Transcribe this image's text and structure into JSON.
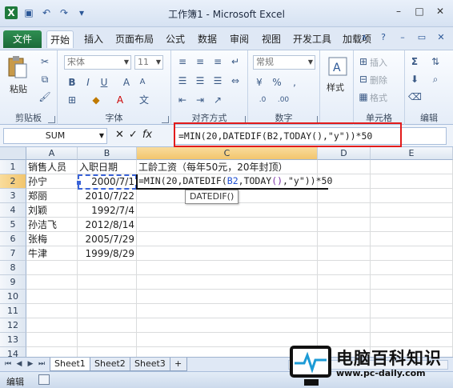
{
  "window": {
    "title": "工作簿1 - Microsoft Excel"
  },
  "tabs": [
    "文件",
    "开始",
    "插入",
    "页面布局",
    "公式",
    "数据",
    "审阅",
    "视图",
    "开发工具",
    "加载项"
  ],
  "ribbon": {
    "clipboard": {
      "label": "剪贴板",
      "paste": "粘贴"
    },
    "font": {
      "label": "字体",
      "name": "宋体",
      "size": "11"
    },
    "alignment": {
      "label": "对齐方式"
    },
    "number": {
      "label": "数字",
      "format": "常规"
    },
    "styles": {
      "label": "样式"
    },
    "cells": {
      "label": "单元格",
      "insert": "插入",
      "delete": "删除",
      "format": "格式"
    },
    "editing": {
      "label": "编辑"
    }
  },
  "formula_bar": {
    "name_box": "SUM",
    "cancel": "✕",
    "enter": "✓",
    "fx": "fx",
    "formula": "=MIN(20,DATEDIF(B2,TODAY(),\"y\"))*50"
  },
  "grid": {
    "columns": [
      "A",
      "B",
      "C",
      "D",
      "E"
    ],
    "rows": [
      "1",
      "2",
      "3",
      "4",
      "5",
      "6",
      "7",
      "8",
      "9",
      "10",
      "11",
      "12",
      "13",
      "14"
    ],
    "data": [
      [
        "销售人员",
        "入职日期",
        "工龄工资（每年50元，20年封顶）"
      ],
      [
        "孙宁",
        "2000/7/1",
        ""
      ],
      [
        "郑丽",
        "2010/7/22",
        ""
      ],
      [
        "刘颖",
        "1992/7/4",
        ""
      ],
      [
        "孙洁飞",
        "2012/8/14",
        ""
      ],
      [
        "张梅",
        "2005/7/29",
        ""
      ],
      [
        "牛津",
        "1999/8/29",
        ""
      ]
    ],
    "edit_cell": {
      "part1": "=MIN(20,DATEDIF(",
      "ref": "B2",
      "part2": ",TODAY",
      "purple": "()",
      "part3": ",\"y\"",
      "part4": "))*50"
    },
    "tooltip": "DATEDIF()"
  },
  "sheets": [
    "Sheet1",
    "Sheet2",
    "Sheet3"
  ],
  "status": {
    "mode": "编辑"
  },
  "watermark": {
    "title": "电脑百科知识",
    "url": "www.pc-daily.com"
  }
}
